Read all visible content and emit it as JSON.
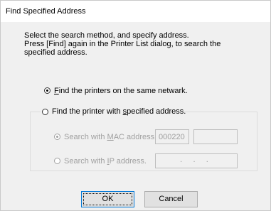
{
  "window": {
    "title": "Find Specified Address"
  },
  "description": {
    "line1": "Select the search method, and specify address.",
    "line2": "Press [Find] again in the Printer List dialog, to search the",
    "line3": "specified address."
  },
  "options": {
    "same_network": {
      "mnemonic": "F",
      "rest": "ind the printers on the same netwark.",
      "selected": true
    },
    "specified_address": {
      "pre": "Find the printer with ",
      "mnemonic": "s",
      "post": "pecified address.",
      "selected": false
    }
  },
  "mac": {
    "pre": "Search with ",
    "mnemonic": "M",
    "post": "AC address.",
    "prefix_value": "000220",
    "value": "",
    "selected": true,
    "enabled": false
  },
  "ip": {
    "pre": "Search with ",
    "mnemonic": "I",
    "post": "P address.",
    "value": "  .     .     .",
    "selected": false,
    "enabled": false
  },
  "buttons": {
    "ok": "OK",
    "cancel": "Cancel"
  }
}
